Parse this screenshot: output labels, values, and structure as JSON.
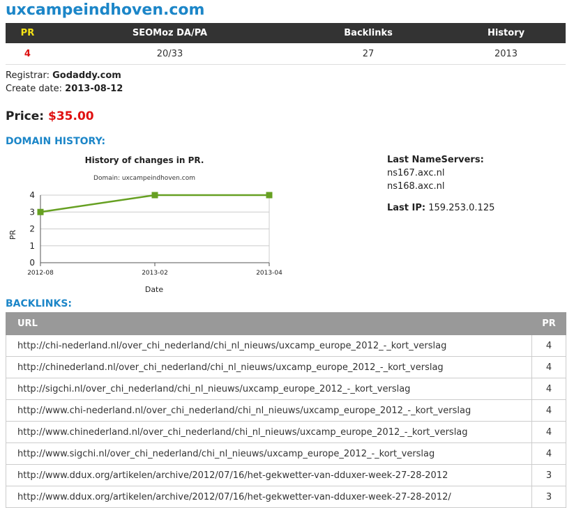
{
  "site": {
    "title": "uxcampeindhoven.com"
  },
  "stats": {
    "headers": [
      "PR",
      "SEOMoz DA/PA",
      "Backlinks",
      "History"
    ],
    "values": [
      "4",
      "20/33",
      "27",
      "2013"
    ]
  },
  "registrar": {
    "label": "Registrar:",
    "value": "Godaddy.com"
  },
  "create_date": {
    "label": "Create date:",
    "value": "2013-08-12"
  },
  "price": {
    "label": "Price:",
    "value": "$35.00"
  },
  "domain_history": {
    "heading": "DOMAIN HISTORY:"
  },
  "chart_data": {
    "type": "line",
    "title": "History of changes in PR.",
    "subtitle": "Domain: uxcampeindhoven.com",
    "xlabel": "Date",
    "ylabel": "PR",
    "x": [
      "2012-08",
      "2013-02",
      "2013-04"
    ],
    "series": [
      {
        "values": [
          3,
          4,
          4
        ]
      }
    ],
    "ylim": [
      0,
      4
    ],
    "yticks": [
      "0",
      "1",
      "2",
      "3",
      "4"
    ],
    "grid": true,
    "line_color": "#66a022"
  },
  "nameservers": {
    "label": "Last NameServers:",
    "items": [
      "ns167.axc.nl",
      "ns168.axc.nl"
    ]
  },
  "last_ip": {
    "label": "Last IP:",
    "value": "159.253.0.125"
  },
  "backlinks": {
    "heading": "BACKLINKS:",
    "columns": [
      "URL",
      "PR"
    ],
    "rows": [
      {
        "url": "http://chi-nederland.nl/over_chi_nederland/chi_nl_nieuws/uxcamp_europe_2012_-_kort_verslag",
        "pr": "4"
      },
      {
        "url": "http://chinederland.nl/over_chi_nederland/chi_nl_nieuws/uxcamp_europe_2012_-_kort_verslag",
        "pr": "4"
      },
      {
        "url": "http://sigchi.nl/over_chi_nederland/chi_nl_nieuws/uxcamp_europe_2012_-_kort_verslag",
        "pr": "4"
      },
      {
        "url": "http://www.chi-nederland.nl/over_chi_nederland/chi_nl_nieuws/uxcamp_europe_2012_-_kort_verslag",
        "pr": "4"
      },
      {
        "url": "http://www.chinederland.nl/over_chi_nederland/chi_nl_nieuws/uxcamp_europe_2012_-_kort_verslag",
        "pr": "4"
      },
      {
        "url": "http://www.sigchi.nl/over_chi_nederland/chi_nl_nieuws/uxcamp_europe_2012_-_kort_verslag",
        "pr": "4"
      },
      {
        "url": "http://www.ddux.org/artikelen/archive/2012/07/16/het-gekwetter-van-dduxer-week-27-28-2012",
        "pr": "3"
      },
      {
        "url": "http://www.ddux.org/artikelen/archive/2012/07/16/het-gekwetter-van-dduxer-week-27-28-2012/",
        "pr": "3"
      }
    ]
  }
}
